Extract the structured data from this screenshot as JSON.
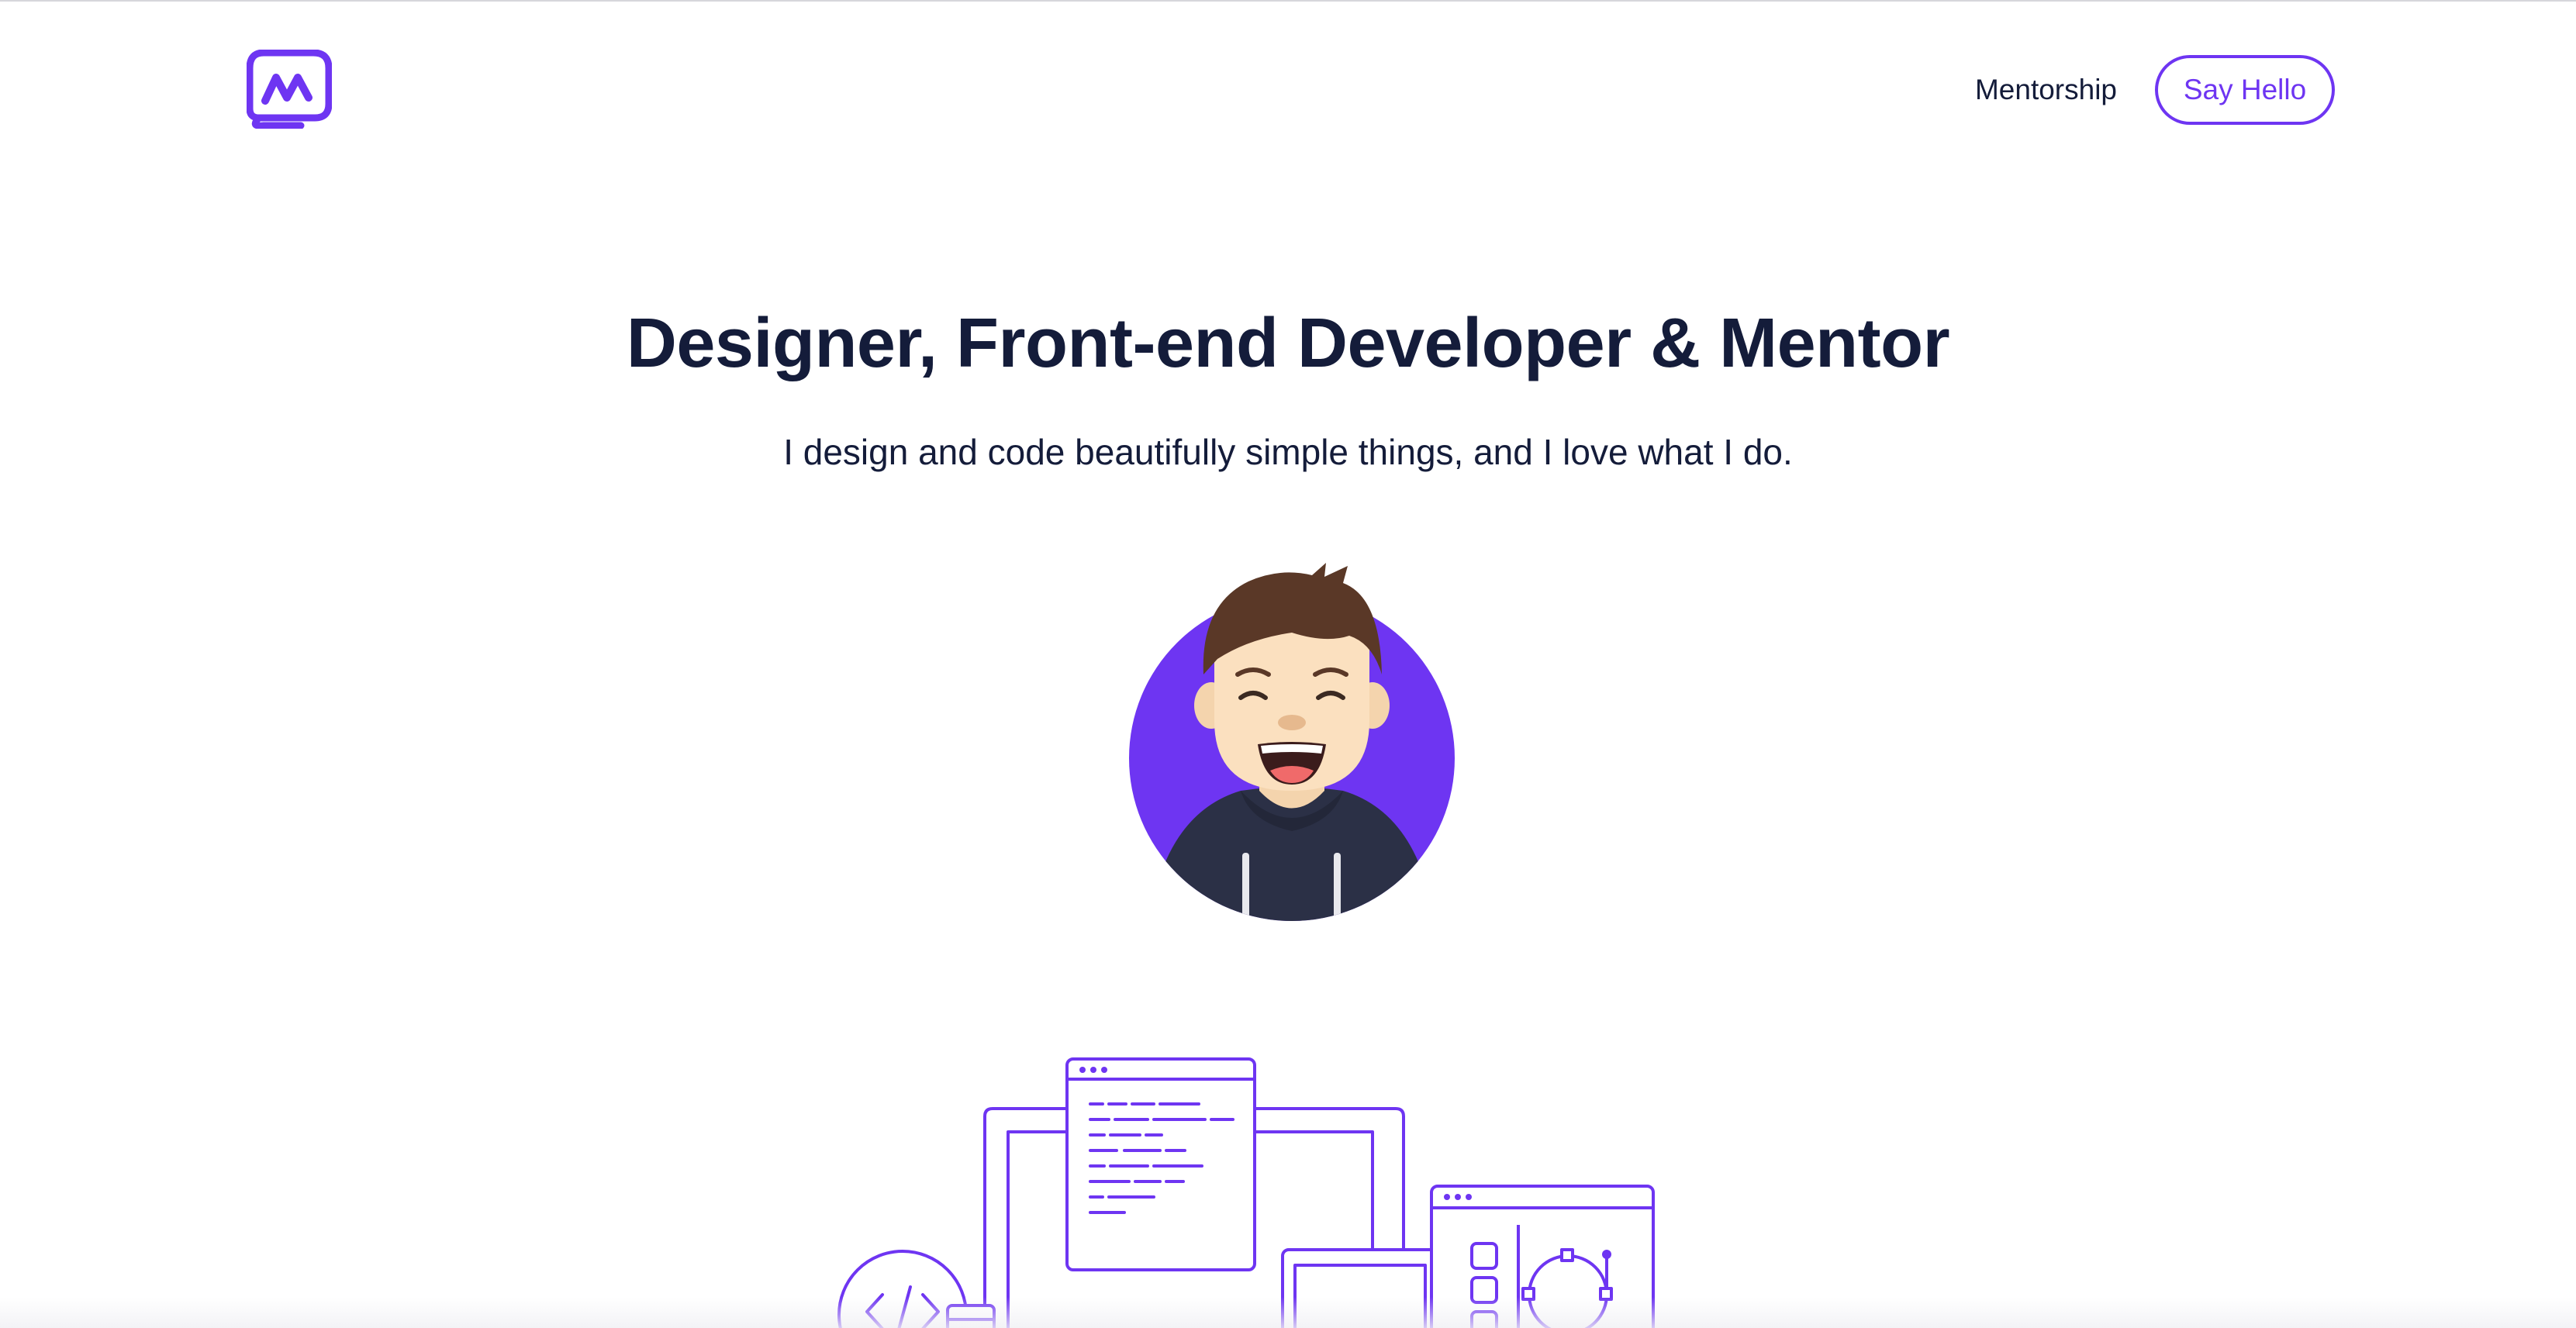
{
  "header": {
    "logo_name": "monogram-logo",
    "nav": {
      "mentorship_label": "Mentorship"
    },
    "cta": {
      "say_hello_label": "Say Hello"
    }
  },
  "hero": {
    "title": "Designer, Front-end Developer & Mentor",
    "subtitle": "I design and code beautifully simple things, and I love what I do."
  },
  "theme": {
    "accent": "#6e35f2",
    "text": "#141c3a",
    "avatar_background": "#6e35f2",
    "hoodie": "#2b3046"
  },
  "icons": [
    "monogram-logo",
    "avatar-illustration",
    "devices-illustration",
    "code-brackets-icon",
    "vector-circle-icon"
  ]
}
